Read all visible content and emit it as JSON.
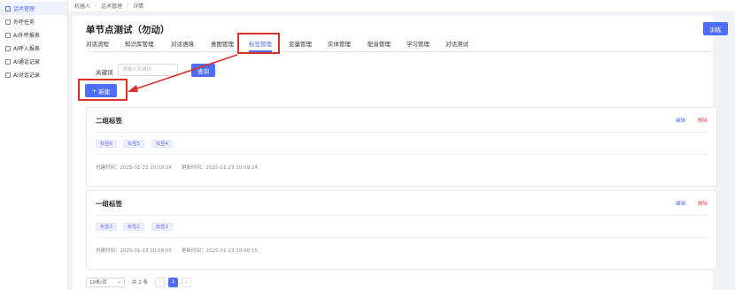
{
  "sidebar": {
    "items": [
      {
        "label": "话术管理",
        "active": true
      },
      {
        "label": "外呼任务"
      },
      {
        "label": "AI外呼报表"
      },
      {
        "label": "AI呼入报表"
      },
      {
        "label": "AI通话记录"
      },
      {
        "label": "AI对话记录"
      }
    ]
  },
  "breadcrumb": {
    "items": [
      "机器人",
      "话术管理",
      "详情"
    ],
    "sep": "/"
  },
  "page": {
    "title": "单节点测试（勿动）",
    "train_label": "训练"
  },
  "tabs": [
    {
      "label": "对话流程"
    },
    {
      "label": "知识库管理"
    },
    {
      "label": "对话语境"
    },
    {
      "label": "意图管理"
    },
    {
      "label": "标签管理",
      "active": true
    },
    {
      "label": "变量管理"
    },
    {
      "label": "实体管理"
    },
    {
      "label": "配音管理"
    },
    {
      "label": "学习管理"
    },
    {
      "label": "对话测试"
    }
  ],
  "search": {
    "label": "关键词",
    "placeholder": "请输入关键词",
    "query_label": "查询"
  },
  "new_button": {
    "icon": "+",
    "label": "新建"
  },
  "cards": [
    {
      "title": "二组标签",
      "edit": "编辑",
      "delete": "删除",
      "tags": [
        "标签6",
        "标签5",
        "标签4"
      ],
      "created": "创建时间：2025-01-23 10:09:24",
      "updated": "更新时间：2025-01-23 10:09:24"
    },
    {
      "title": "一组标签",
      "edit": "编辑",
      "delete": "删除",
      "tags": [
        "标签3",
        "标签2",
        "标签1"
      ],
      "created": "创建时间：2025-01-23 10:08:55",
      "updated": "更新时间：2025-01-23 10:08:55"
    }
  ],
  "pager": {
    "page_size": "10条/页",
    "total": "共 2 条",
    "current": "1",
    "prev": "‹",
    "next": "›"
  },
  "colors": {
    "accent": "#4f6ef7",
    "highlight": "#d9322b",
    "danger": "#e5484d"
  }
}
